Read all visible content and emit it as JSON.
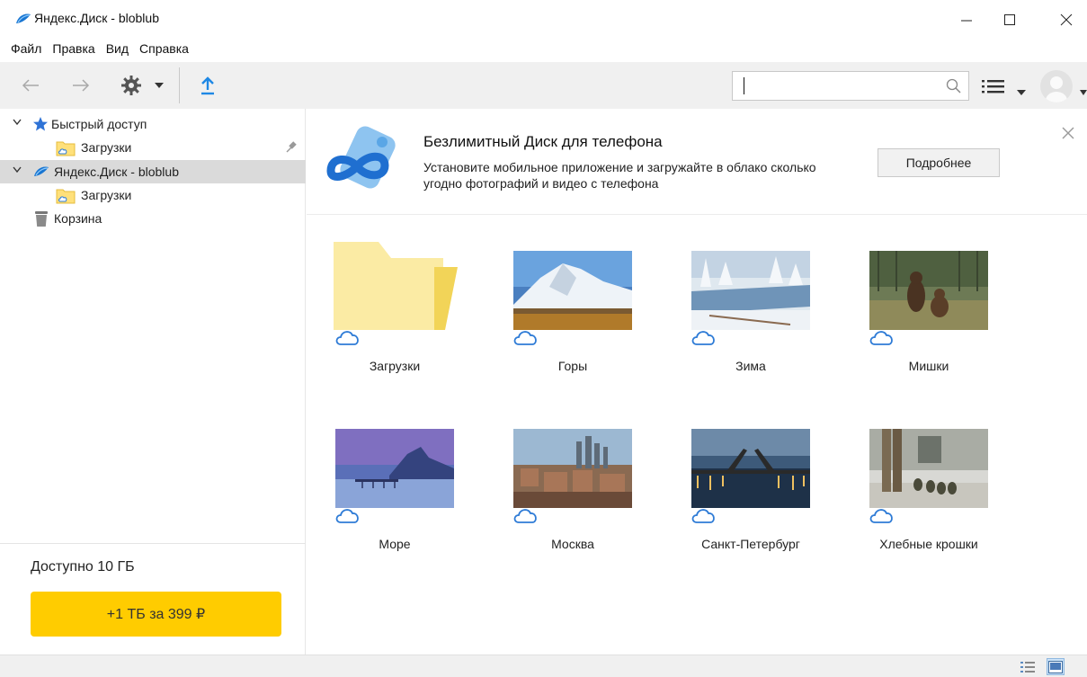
{
  "window": {
    "title": "Яндекс.Диск - bloblub"
  },
  "menu": {
    "items": [
      "Файл",
      "Правка",
      "Вид",
      "Справка"
    ]
  },
  "toolbar": {
    "back_icon": "arrow-left-icon",
    "forward_icon": "arrow-right-icon",
    "settings_icon": "gear-icon",
    "upload_icon": "upload-icon",
    "search_placeholder": "",
    "search_value": "",
    "accent": "#1e88e5"
  },
  "sidebar": {
    "items": [
      {
        "label": "Быстрый доступ"
      },
      {
        "label": "Загрузки"
      },
      {
        "label": "Яндекс.Диск - bloblub"
      },
      {
        "label": "Загрузки"
      },
      {
        "label": "Корзина"
      }
    ],
    "available": "Доступно 10 ГБ",
    "upgrade_label": "+1 ТБ за 399 ₽",
    "upgrade_color": "#ffcc00"
  },
  "banner": {
    "title": "Безлимитный Диск для телефона",
    "text": "Установите мобильное приложение и загружайте в облако сколько угодно фотографий и видео с телефона",
    "more_label": "Подробнее"
  },
  "files": [
    {
      "name": "Загрузки",
      "kind": "folder"
    },
    {
      "name": "Горы",
      "kind": "image"
    },
    {
      "name": "Зима",
      "kind": "image"
    },
    {
      "name": "Мишки",
      "kind": "image"
    },
    {
      "name": "Море",
      "kind": "image"
    },
    {
      "name": "Москва",
      "kind": "image"
    },
    {
      "name": "Санкт-Петербург",
      "kind": "image"
    },
    {
      "name": "Хлебные крошки",
      "kind": "image"
    }
  ]
}
